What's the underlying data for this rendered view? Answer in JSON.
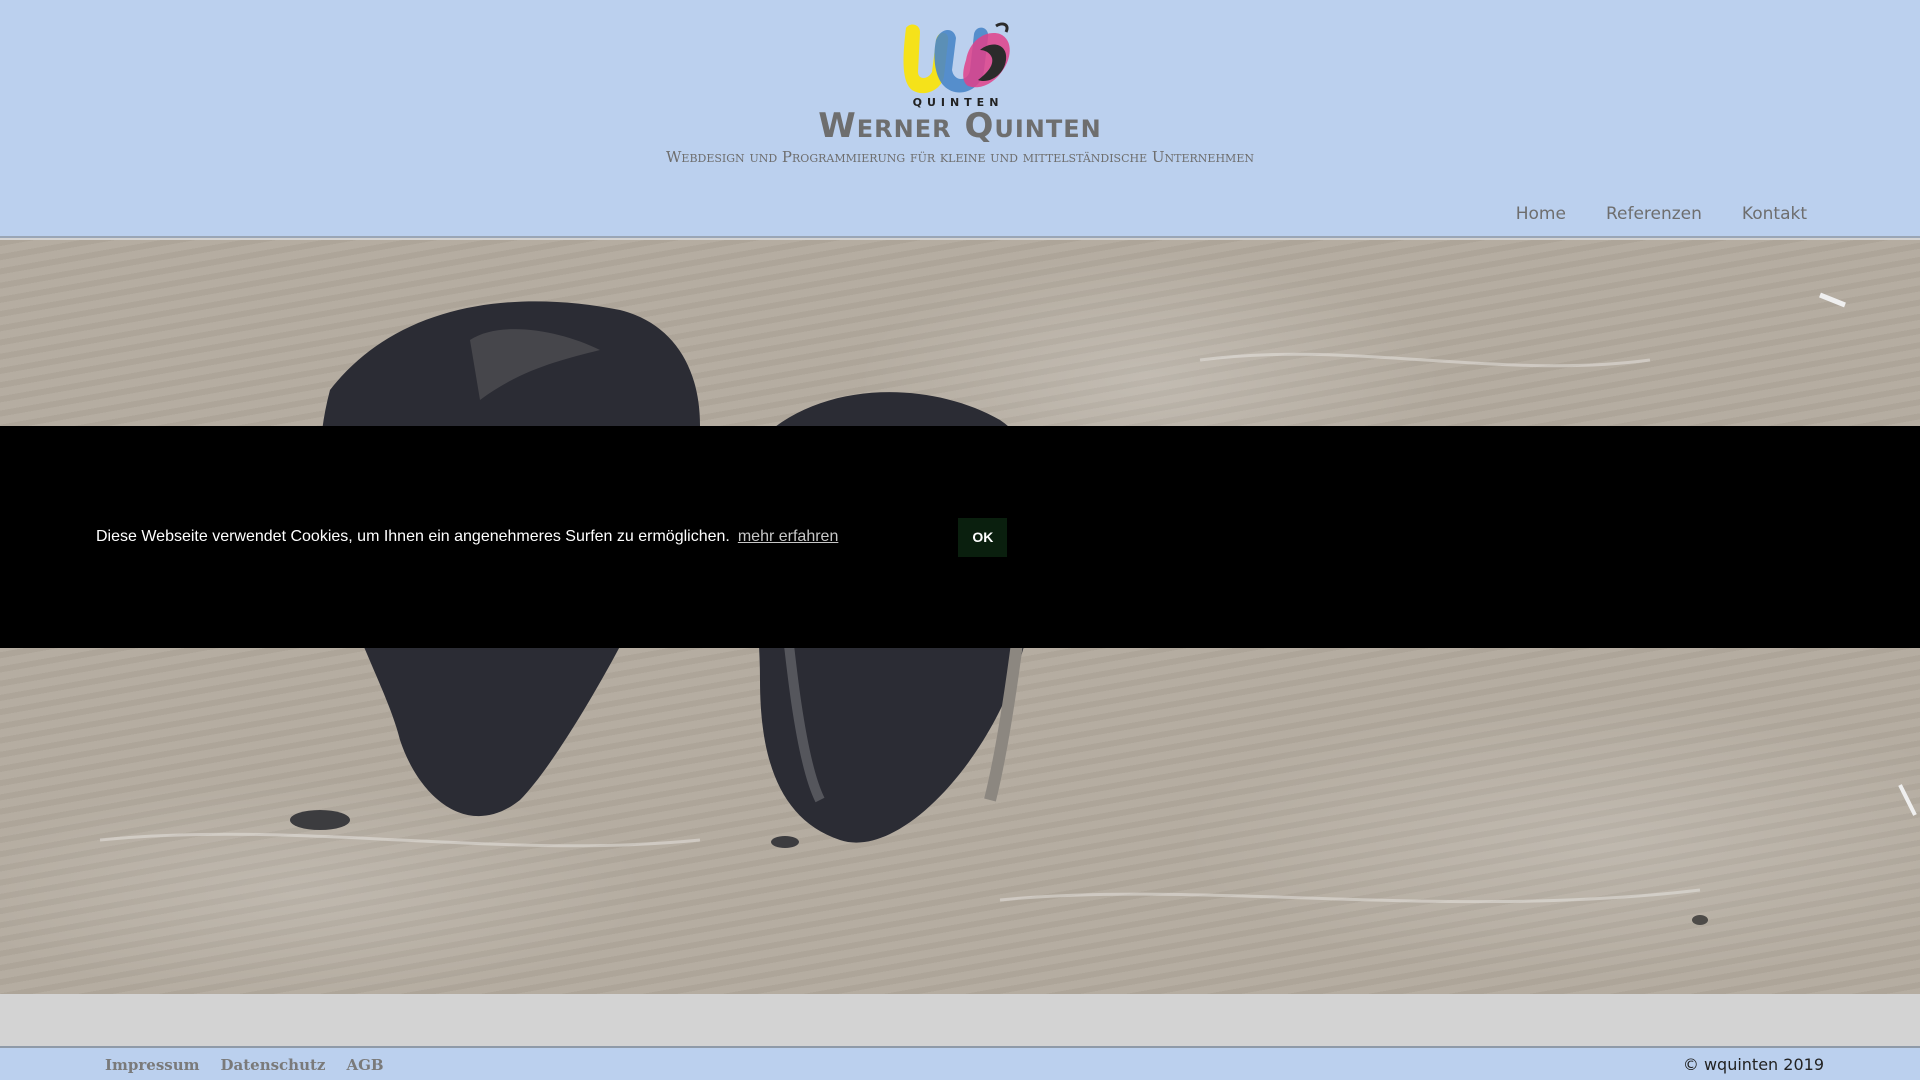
{
  "header": {
    "logo_text": "QUINTEN",
    "site_title": "Werner Quinten",
    "subtitle": "Webdesign und Programmierung für kleine und mittelständische Unternehmen"
  },
  "nav": {
    "items": [
      {
        "label": "Home"
      },
      {
        "label": "Referenzen"
      },
      {
        "label": "Kontakt"
      }
    ]
  },
  "cookie": {
    "message": "Diese Webseite verwendet Cookies, um Ihnen ein angenehmeres Surfen zu ermöglichen.",
    "link_label": "mehr erfahren",
    "ok_label": "OK"
  },
  "footer": {
    "links": [
      {
        "label": "Impressum"
      },
      {
        "label": "Datenschutz"
      },
      {
        "label": "AGB"
      }
    ],
    "copyright": "© wquinten 2019"
  },
  "colors": {
    "header_bg": "#bbd0ee",
    "cookie_bg": "#000000",
    "ok_button_bg": "#0a1f0e",
    "text_gray": "#6e6e6e"
  }
}
